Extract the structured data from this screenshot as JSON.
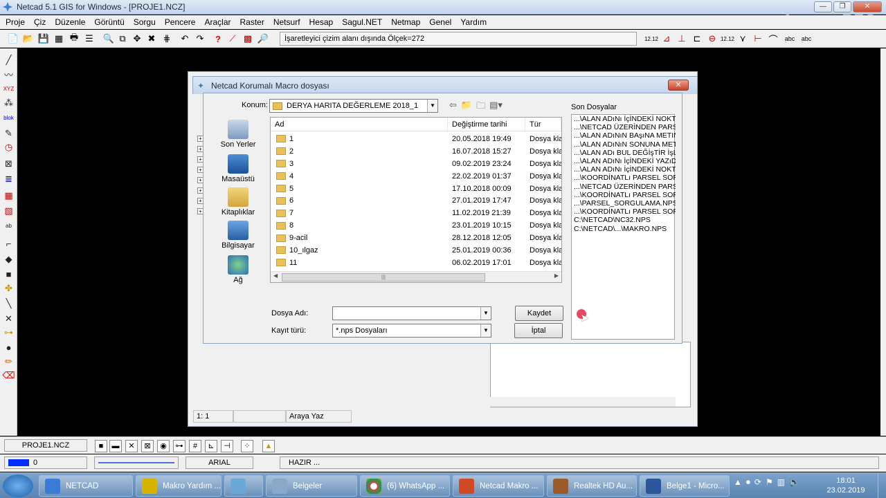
{
  "app": {
    "title": "Netcad 5.1 GIS for Windows - [PROJE1.NCZ]",
    "watermark": "ApowerREC",
    "window_controls": {
      "minimize": "—",
      "restore": "❐",
      "close": "✕"
    }
  },
  "menu": [
    "Proje",
    "Çiz",
    "Düzenle",
    "Görüntü",
    "Sorgu",
    "Pencere",
    "Araçlar",
    "Raster",
    "Netsurf",
    "Hesap",
    "Sagul.NET",
    "Netmap",
    "Genel",
    "Yardım"
  ],
  "toolbar": {
    "status_text": "İşaretleyici çizim alanı dışında Ölçek=272"
  },
  "dialog": {
    "title": "Netcad Korumalı Macro dosyası",
    "close_label": "✕",
    "location_label": "Konum:",
    "location_value": "DERYA HARITA DEĞERLEME 2018_1",
    "places": [
      "Son Yerler",
      "Masaüstü",
      "Kitaplıklar",
      "Bilgisayar",
      "Ağ"
    ],
    "columns": {
      "name": "Ad",
      "date": "Değiştirme tarihi",
      "type": "Tür"
    },
    "files": [
      {
        "name": "1",
        "date": "20.05.2018 19:49",
        "type": "Dosya klas"
      },
      {
        "name": "2",
        "date": "16.07.2018 15:27",
        "type": "Dosya klas"
      },
      {
        "name": "3",
        "date": "09.02.2019 23:24",
        "type": "Dosya klas"
      },
      {
        "name": "4",
        "date": "22.02.2019 01:37",
        "type": "Dosya klas"
      },
      {
        "name": "5",
        "date": "17.10.2018 00:09",
        "type": "Dosya klas"
      },
      {
        "name": "6",
        "date": "27.01.2019 17:47",
        "type": "Dosya klas"
      },
      {
        "name": "7",
        "date": "11.02.2019 21:39",
        "type": "Dosya klas"
      },
      {
        "name": "8",
        "date": "23.01.2019 10:15",
        "type": "Dosya klas"
      },
      {
        "name": "9-acil",
        "date": "28.12.2018 12:05",
        "type": "Dosya klas"
      },
      {
        "name": "10_ılgaz",
        "date": "25.01.2019 00:36",
        "type": "Dosya klas"
      },
      {
        "name": "11",
        "date": "06.02.2019 17:01",
        "type": "Dosya klas"
      }
    ],
    "filename_label": "Dosya Adı:",
    "filename_value": "",
    "filetype_label": "Kayıt türü:",
    "filetype_value": "*.nps Dosyaları",
    "save_label": "Kaydet",
    "cancel_label": "İptal",
    "recent_label": "Son Dosyalar",
    "recent_files": [
      "...\\ALAN ADıNı İçİNDEKİ NOKTA",
      "...\\NETCAD ÜZERİNDEN PARS",
      "...\\ALAN ADıNıN BAşıNA METIN",
      "...\\ALAN ADıNıN SONUNA MET",
      "...\\ALAN ADı BUL DEĞİşTİR İşLE",
      "...\\ALAN ADıNı İçİNDEKİ YAZıDA",
      "...\\ALAN ADıNı İçİNDEKİ NOKTA",
      "...\\KOORDİNATLı PARSEL SOR",
      "...\\NETCAD ÜZERİNDEN PARS",
      "...\\KOORDİNATLı PARSEL SOR",
      "...\\PARSEL_SORGULAMA.NPS",
      "...\\KOORDİNATLı PARSEL SOR",
      "C:\\NETCAD\\NC32.NPS",
      "C:\\NETCAD\\...\\MAKRO.NPS"
    ]
  },
  "bg_window": {
    "status_scale": "1: 1",
    "status_text": "Araya Yaz"
  },
  "bottom": {
    "project": "PROJE1.NCZ",
    "layer_value": "0",
    "font": "ARIAL",
    "status": "HAZIR ..."
  },
  "taskbar": {
    "items": [
      {
        "label": "NETCAD",
        "color": "#3a7bd5"
      },
      {
        "label": "Makro Yardım ...",
        "color": "#d7b400"
      },
      {
        "label": "",
        "color": "#6aa8d8"
      },
      {
        "label": "Belgeler",
        "color": "#8aa8c8"
      },
      {
        "label": "(6) WhatsApp ...",
        "color": "#db4437"
      },
      {
        "label": "Netcad Makro ...",
        "color": "#d04a25"
      },
      {
        "label": "Realtek HD Au...",
        "color": "#9a5a2a"
      },
      {
        "label": "Belge1 - Micro...",
        "color": "#2b579a"
      }
    ],
    "time": "18:01",
    "date": "23.02.2019"
  }
}
